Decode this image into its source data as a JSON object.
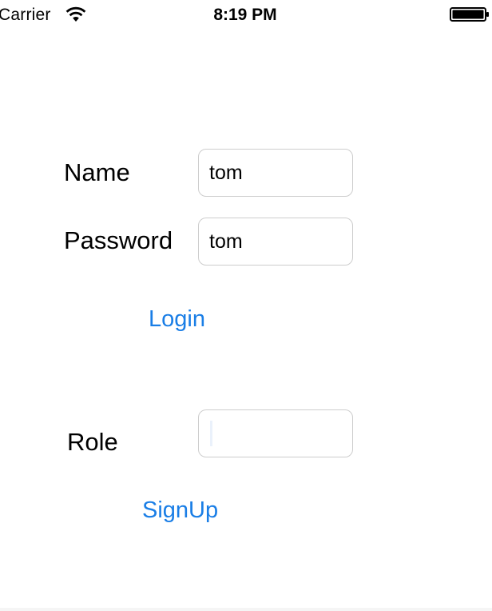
{
  "status_bar": {
    "carrier": "Carrier",
    "time": "8:19 PM",
    "wifi_icon": "wifi-icon",
    "battery_icon": "battery-icon"
  },
  "form": {
    "name_label": "Name",
    "name_value": "tom",
    "password_label": "Password",
    "password_value": "tom",
    "login_label": "Login",
    "role_label": "Role",
    "role_value": "",
    "signup_label": "SignUp"
  },
  "colors": {
    "accent": "#1a7ee6",
    "field_border": "#cdcdcd",
    "background": "#ffffff"
  }
}
